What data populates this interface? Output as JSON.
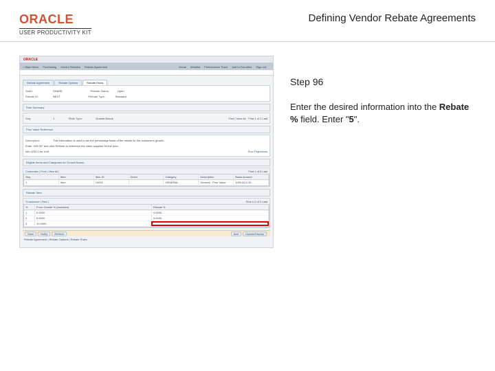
{
  "header": {
    "logo_main": "ORACLE",
    "logo_sub": "USER PRODUCTIVITY KIT",
    "title": "Defining Vendor Rebate Agreements"
  },
  "sidebar": {
    "step_label": "Step 96",
    "instruction_prefix": "Enter the desired information into the ",
    "instruction_bold": "Rebate %",
    "instruction_mid": " field. Enter \"",
    "instruction_value": "5",
    "instruction_suffix": "\"."
  },
  "shot": {
    "nav": {
      "items": [
        "< Main Menu",
        "Purchasing",
        "Vendor Rebates",
        "Rebate Agreement"
      ],
      "menus": [
        "Home",
        "Worklist",
        "Performance Trace",
        "Add to Favorites",
        "Sign out"
      ]
    },
    "tabs": [
      "Rebate Agreement",
      "Rebate Options",
      "Rebate Rules"
    ],
    "fields": {
      "setid_lbl": "SetID:",
      "setid_val": "SHARE",
      "reb_status_lbl": "*Rebate Status:",
      "reb_status_val": "Open",
      "reb_id_lbl": "Rebate ID:",
      "reb_id_val": "NEXT",
      "reb_type_lbl": "*Rebate Type:",
      "reb_type_val": "Standard"
    },
    "rule_summary": "Rule Summary",
    "rule_row": {
      "seq_lbl": "Seq:",
      "seq": "1",
      "rule_type_lbl": "*Rule Type:",
      "rule_type": "Growth Bonus",
      "nav": "First  1 of 1  Last",
      "find": "Find | View All"
    },
    "pvr": {
      "title": "Prior Value Reference",
      "desc_lbl": "Description:",
      "desc": "This information is used to set the percentage basis of the rebate for the customer's growth.",
      "info": "Enter \"000.00\" and click Refresh to reference the value supplied for the prior."
    },
    "info_link": "info 4230.0 for Unit",
    "run": "Run Projections",
    "eligible": {
      "title": "Eligible Items and Categories for Growth Bonus",
      "cust": "Customize | Find | View All |",
      "nav": "First  1 of 5  Last",
      "hdr": [
        "Seq",
        "Item",
        "Item ID",
        "Descr",
        "Category",
        "Description",
        "Basis Amount"
      ],
      "r": [
        "1",
        "Item",
        "10001",
        "",
        "GENERAL",
        "General - Prior Value",
        "1000.00 1.00"
      ]
    },
    "tiers": {
      "title": "Rebate Tiers",
      "cust": "*Customize | Find |",
      "nav": "First  1-2 of 2  Last",
      "hdr": [
        "%",
        "From Growth % (Inclusive)",
        "Rebate %"
      ],
      "rows": [
        [
          "1",
          "0.0000",
          "0.0000"
        ],
        [
          "2",
          "5.0000",
          "5.0000"
        ],
        [
          "3",
          "10.0000",
          ""
        ]
      ]
    },
    "footer": {
      "left": [
        "Save",
        "Notify",
        "Refresh"
      ],
      "right": [
        "Add",
        "Update/Display"
      ],
      "links": "Rebate Agreement | Rebate Options | Rebate Rules"
    }
  }
}
